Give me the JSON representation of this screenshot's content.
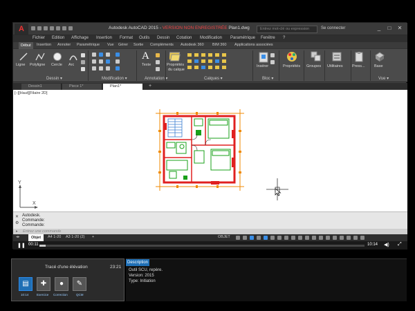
{
  "titlebar": {
    "app_logo": "A",
    "title_prefix": "Autodesk AutoCAD 2015 - ",
    "title_red": "VERSION NON ENREGISTRÉE",
    "title_suffix": "   Plan1.dwg",
    "search_placeholder": "Entrez mot-clé ou expression",
    "signin": "Se connecter",
    "window_buttons": [
      "_",
      "□",
      "✕"
    ]
  },
  "menubar": [
    "Fichier",
    "Edition",
    "Affichage",
    "Insertion",
    "Format",
    "Outils",
    "Dessin",
    "Cotation",
    "Modification",
    "Paramétrique",
    "Fenêtre",
    "?"
  ],
  "ribbon_tabs": [
    "Début",
    "Insertion",
    "Annoter",
    "Paramétrique",
    "Vue",
    "Gérer",
    "Sortie",
    "Compléments",
    "Autodesk 360",
    "BIM 360",
    "Applications associées"
  ],
  "ribbon": {
    "draw_tools": [
      "Ligne",
      "Polyligne",
      "Cercle",
      "Arc"
    ],
    "text_tool": "Texte",
    "layer_props": [
      "Propriétés",
      "du calque"
    ],
    "insert_tool": "Insérer",
    "properties_tool": "Propriétés",
    "groups_tool": "Groupes",
    "utilities_tool": "Utilitaires",
    "clipboard_tool": "Press...",
    "base_tool": "Base",
    "panels": [
      "Dessin ▾",
      "Modification ▾",
      "Annotation ▾",
      "Calques ▾",
      "Bloc ▾",
      "Vue ▾"
    ]
  },
  "doc_tabs": [
    "Dessin1",
    "Piece 1*",
    "Plan1*"
  ],
  "canvas": {
    "view_label": "[−][Haut][Filaire 2D]",
    "ucs_y": "Y",
    "ucs_x": "X"
  },
  "command": {
    "history": [
      "Autodesk.",
      "Commande:",
      "Commande:"
    ],
    "placeholder": "Entrez une commande"
  },
  "status_tabs": [
    "Objet",
    "A4 1-20",
    "A3 1-20 (2)",
    "+"
  ],
  "status_right": "OBJET",
  "player": {
    "current": "00:11",
    "total": "10:14",
    "progress": 0.02
  },
  "lesson": {
    "title": "Tracé d'une élévation",
    "duration": "23:21",
    "items": [
      {
        "label": "10:14",
        "icon": "film-icon"
      },
      {
        "label": "Exercice",
        "icon": "puzzle-icon"
      },
      {
        "label": "Correction",
        "icon": "bulb-icon"
      },
      {
        "label": "QCM",
        "icon": "quiz-icon"
      }
    ]
  },
  "description": {
    "tab": "Description",
    "lines": [
      "Outil SCU, repère.",
      "Version: 2015",
      "Type: Initiation"
    ]
  },
  "colors": {
    "accent": "#1f6fb5",
    "wall": "#e02020",
    "dim": "#f08a00",
    "furniture": "#19a019"
  }
}
